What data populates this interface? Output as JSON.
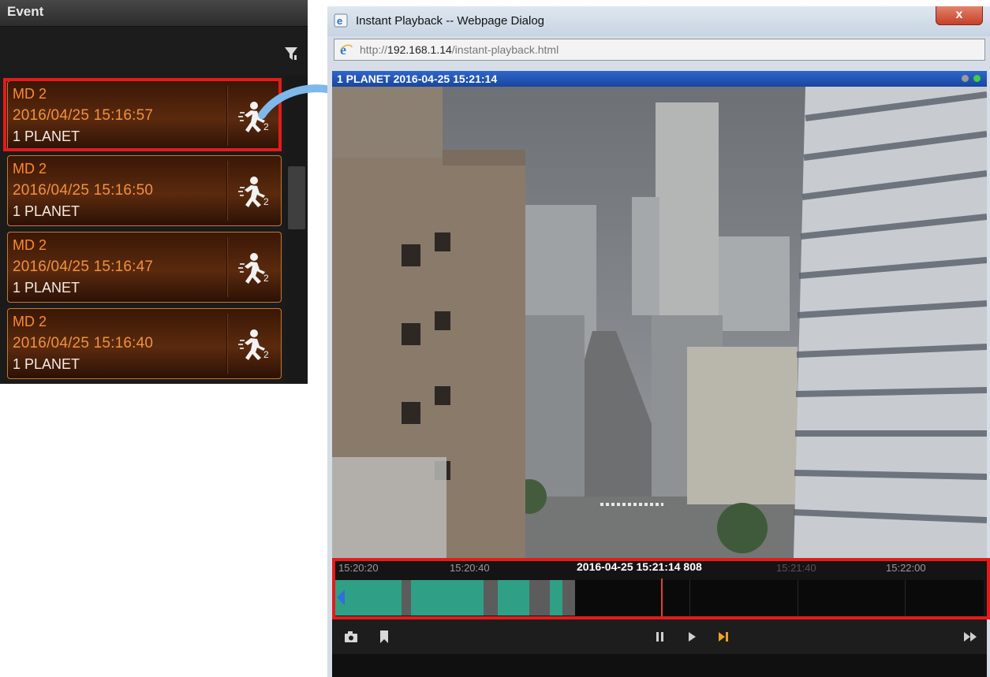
{
  "event_panel": {
    "title": "Event",
    "events": [
      {
        "type": "MD 2",
        "time": "2016/04/25 15:16:57",
        "camera": "1 PLANET",
        "icon": "motion-person-icon",
        "highlighted": true
      },
      {
        "type": "MD 2",
        "time": "2016/04/25 15:16:50",
        "camera": "1 PLANET",
        "icon": "motion-person-icon"
      },
      {
        "type": "MD 2",
        "time": "2016/04/25 15:16:47",
        "camera": "1 PLANET",
        "icon": "motion-person-icon"
      },
      {
        "type": "MD 2",
        "time": "2016/04/25 15:16:40",
        "camera": "1 PLANET",
        "icon": "motion-person-icon"
      }
    ]
  },
  "dialog": {
    "title": "Instant Playback -- Webpage Dialog",
    "close_label": "x",
    "url_prefix": "http://",
    "url_host": "192.168.1.14",
    "url_path": "/instant-playback.html",
    "video_label": "1 PLANET   2016-04-25 15:21:14",
    "status_dots": [
      "#9a9a9a",
      "#3fcf3f"
    ]
  },
  "timeline": {
    "current_time": "2016-04-25 15:21:14 808",
    "tick_labels": [
      "15:20:20",
      "15:20:40",
      "15:21:40",
      "15:22:00"
    ],
    "colors": {
      "recorded": "#2fa085",
      "gap": "#5c5c5c",
      "cursor": "#e43b3b",
      "highlight": "#e41b1b"
    }
  },
  "controls": {
    "left": [
      "snapshot-icon",
      "bookmark-icon"
    ],
    "center": [
      "pause-icon",
      "play-icon",
      "step-frame-icon"
    ],
    "right": [
      "fast-forward-icon"
    ]
  }
}
